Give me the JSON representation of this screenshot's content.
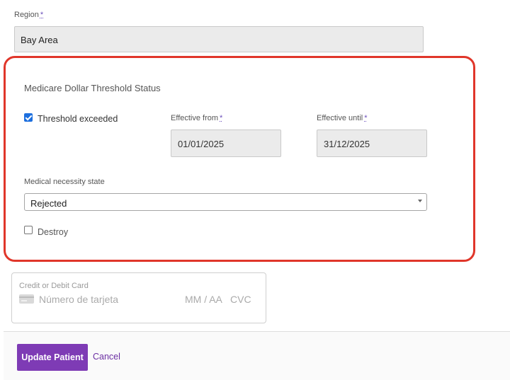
{
  "region": {
    "label": "Region",
    "required_mark": "*",
    "value": "Bay Area"
  },
  "threshold_section": {
    "title": "Medicare Dollar Threshold Status",
    "threshold_exceeded": {
      "label": "Threshold exceeded",
      "checked": true
    },
    "effective_from": {
      "label": "Effective from",
      "required_mark": "*",
      "value": "01/01/2025"
    },
    "effective_until": {
      "label": "Effective until",
      "required_mark": "*",
      "value": "31/12/2025"
    },
    "medical_necessity": {
      "label": "Medical necessity state",
      "selected": "Rejected"
    },
    "destroy": {
      "label": "Destroy",
      "checked": false
    },
    "highlight_color": "#e0362a"
  },
  "card": {
    "label": "Credit or Debit Card",
    "number_placeholder": "Número de tarjeta",
    "expiry_placeholder": "MM / AA",
    "cvc_placeholder": "CVC",
    "icon": "credit-card-icon"
  },
  "actions": {
    "update_label": "Update Patient",
    "cancel_label": "Cancel",
    "primary_color": "#7e3bb5"
  }
}
